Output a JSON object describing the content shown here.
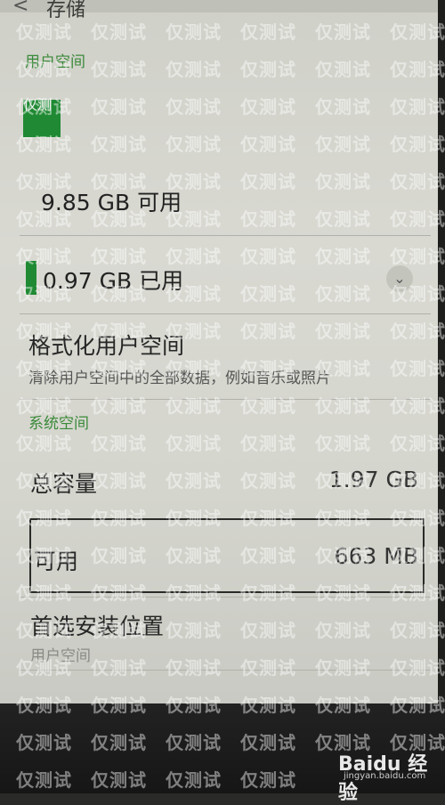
{
  "header": {
    "back_icon": "<",
    "title": "存储"
  },
  "user_space": {
    "section_label": "用户空间",
    "usage_block_label": "仅测",
    "free": "9.85 GB 可用",
    "used": "0.97 GB 已用",
    "expand_icon": "chevron-down-icon"
  },
  "format": {
    "title": "格式化用户空间",
    "description": "清除用户空间中的全部数据，例如音乐或照片"
  },
  "system_space": {
    "section_label": "系统空间",
    "total_label": "总容量",
    "total_value": "1.97 GB",
    "available_label": "可用",
    "available_value": "663 MB"
  },
  "install_location": {
    "title": "首选安装位置",
    "value": "用户空间"
  },
  "watermark": {
    "text": "仅测试",
    "brand": "Baidu 经验",
    "url": "jingyan.baidu.com"
  },
  "colors": {
    "accent_green": "#1f8a33",
    "section_green": "#3a8a3a"
  }
}
